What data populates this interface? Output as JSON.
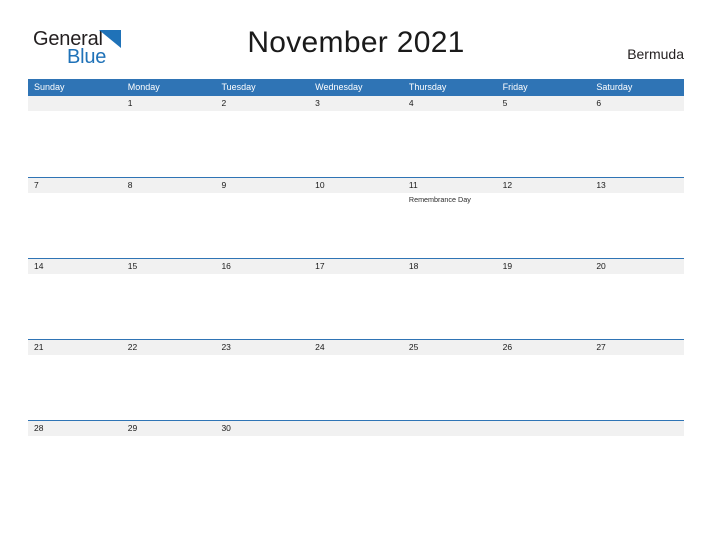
{
  "brand": {
    "name_part1": "General",
    "name_part2": "Blue",
    "triangle_color": "#1f72b8",
    "text_color": "#231f20"
  },
  "header": {
    "title": "November 2021",
    "country": "Bermuda"
  },
  "colors": {
    "header_blue": "#2f74b5",
    "date_band_gray": "#f1f1f1",
    "page_background": "#ffffff",
    "text_dark": "#1a1a1a"
  },
  "calendar": {
    "weekdays": [
      "Sunday",
      "Monday",
      "Tuesday",
      "Wednesday",
      "Thursday",
      "Friday",
      "Saturday"
    ],
    "weeks": [
      {
        "days": [
          {
            "date": "",
            "event": ""
          },
          {
            "date": "1",
            "event": ""
          },
          {
            "date": "2",
            "event": ""
          },
          {
            "date": "3",
            "event": ""
          },
          {
            "date": "4",
            "event": ""
          },
          {
            "date": "5",
            "event": ""
          },
          {
            "date": "6",
            "event": ""
          }
        ]
      },
      {
        "days": [
          {
            "date": "7",
            "event": ""
          },
          {
            "date": "8",
            "event": ""
          },
          {
            "date": "9",
            "event": ""
          },
          {
            "date": "10",
            "event": ""
          },
          {
            "date": "11",
            "event": "Remembrance Day"
          },
          {
            "date": "12",
            "event": ""
          },
          {
            "date": "13",
            "event": ""
          }
        ]
      },
      {
        "days": [
          {
            "date": "14",
            "event": ""
          },
          {
            "date": "15",
            "event": ""
          },
          {
            "date": "16",
            "event": ""
          },
          {
            "date": "17",
            "event": ""
          },
          {
            "date": "18",
            "event": ""
          },
          {
            "date": "19",
            "event": ""
          },
          {
            "date": "20",
            "event": ""
          }
        ]
      },
      {
        "days": [
          {
            "date": "21",
            "event": ""
          },
          {
            "date": "22",
            "event": ""
          },
          {
            "date": "23",
            "event": ""
          },
          {
            "date": "24",
            "event": ""
          },
          {
            "date": "25",
            "event": ""
          },
          {
            "date": "26",
            "event": ""
          },
          {
            "date": "27",
            "event": ""
          }
        ]
      },
      {
        "days": [
          {
            "date": "28",
            "event": ""
          },
          {
            "date": "29",
            "event": ""
          },
          {
            "date": "30",
            "event": ""
          },
          {
            "date": "",
            "event": ""
          },
          {
            "date": "",
            "event": ""
          },
          {
            "date": "",
            "event": ""
          },
          {
            "date": "",
            "event": ""
          }
        ]
      }
    ]
  }
}
